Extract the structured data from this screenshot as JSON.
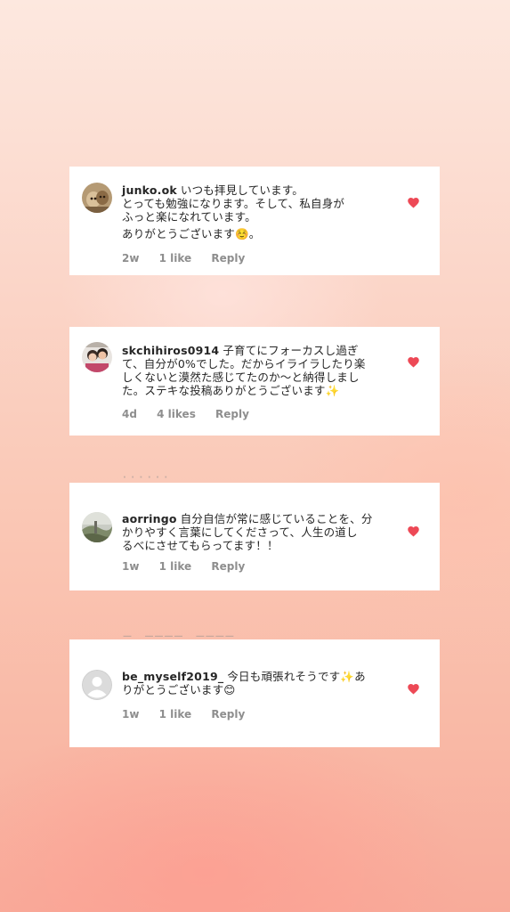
{
  "comments": [
    {
      "username": "junko.ok",
      "lines": [
        "いつも拝見しています。",
        "とっても勉強になります。そして、私自身が",
        "ふっと楽になれています。",
        "ありがとうございます☺️。"
      ],
      "time": "2w",
      "likes": "1 like",
      "reply": "Reply",
      "avatar_icon": "profile-photo-dogs"
    },
    {
      "username": "skchihiros0914",
      "lines": [
        "子育てにフォーカスし過ぎ",
        "て、自分が0%でした。だからイライラしたり楽",
        "しくないと漠然た感じてたのか〜と納得しまし",
        "た。ステキな投稿ありがとうございます✨"
      ],
      "time": "4d",
      "likes": "4 likes",
      "reply": "Reply",
      "avatar_icon": "profile-photo-family"
    },
    {
      "username": "aorringo",
      "lines": [
        "自分自信が常に感じていることを、分",
        "かりやすく言葉にしてくださって、人生の道し",
        "るべにさせてもらってます！！"
      ],
      "time": "1w",
      "likes": "1 like",
      "reply": "Reply",
      "avatar_icon": "profile-photo-landscape"
    },
    {
      "username": "be_myself2019_",
      "lines": [
        "今日も頑張れそうです✨あ",
        "りがとうございます😊"
      ],
      "time": "1w",
      "likes": "1 like",
      "reply": "Reply",
      "avatar_icon": "default-avatar-icon"
    }
  ],
  "colors": {
    "heart": "#ed4956",
    "meta_text": "#8e8e8e",
    "body_text": "#262626"
  }
}
